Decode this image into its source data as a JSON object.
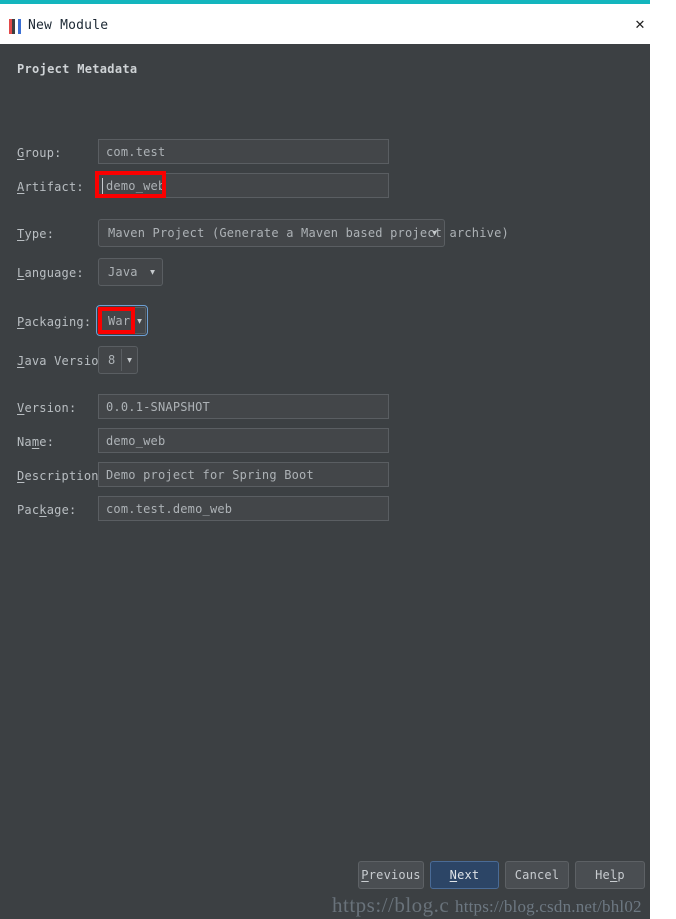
{
  "window": {
    "title": "New Module",
    "close_label": "✕",
    "icon": "intellij-module-icon"
  },
  "section": {
    "title": "Project Metadata"
  },
  "fields": [
    {
      "key": "group",
      "label": "Group:",
      "mnemonic": "G",
      "value": "com.test",
      "kind": "text"
    },
    {
      "key": "artifact",
      "label": "Artifact:",
      "mnemonic": "A",
      "value": "demo_web",
      "kind": "text"
    },
    {
      "key": "type",
      "label": "Type:",
      "mnemonic": "T",
      "value": "Maven Project (Generate a Maven based project archive)",
      "kind": "combo"
    },
    {
      "key": "language",
      "label": "Language:",
      "mnemonic": "L",
      "value": "Java",
      "kind": "combo"
    },
    {
      "key": "packaging",
      "label": "Packaging:",
      "mnemonic": "P",
      "value": "War",
      "kind": "combo"
    },
    {
      "key": "java_version",
      "label": "Java Version:",
      "mnemonic": "J",
      "value": "8",
      "kind": "combo"
    },
    {
      "key": "version",
      "label": "Version:",
      "mnemonic": "V",
      "value": "0.0.1-SNAPSHOT",
      "kind": "text"
    },
    {
      "key": "name",
      "label": "Name:",
      "mnemonic": "m",
      "value": "demo_web",
      "kind": "text"
    },
    {
      "key": "description",
      "label": "Description:",
      "mnemonic": "D",
      "value": "Demo project for Spring Boot",
      "kind": "text"
    },
    {
      "key": "package",
      "label": "Package:",
      "mnemonic": "k",
      "value": "com.test.demo_web",
      "kind": "text"
    }
  ],
  "dropdown_arrow": "▼",
  "buttons": [
    {
      "key": "previous",
      "label": "Previous",
      "primary": false
    },
    {
      "key": "next",
      "label": "Next",
      "primary": true
    },
    {
      "key": "cancel",
      "label": "Cancel",
      "primary": false
    },
    {
      "key": "help",
      "label": "Help",
      "primary": false
    }
  ],
  "annotations": {
    "accent_red": "#fb0000",
    "highlighted_fields": [
      "artifact",
      "packaging"
    ]
  },
  "watermarks": {
    "primary": "https://blog.c",
    "secondary": "https://blog.csdn.net/bhl02"
  },
  "colors": {
    "titlebar_accent": "#13b5bd",
    "dialog_bg": "#3c4043",
    "field_bg": "#434649",
    "primary_button": "#2c4566"
  }
}
